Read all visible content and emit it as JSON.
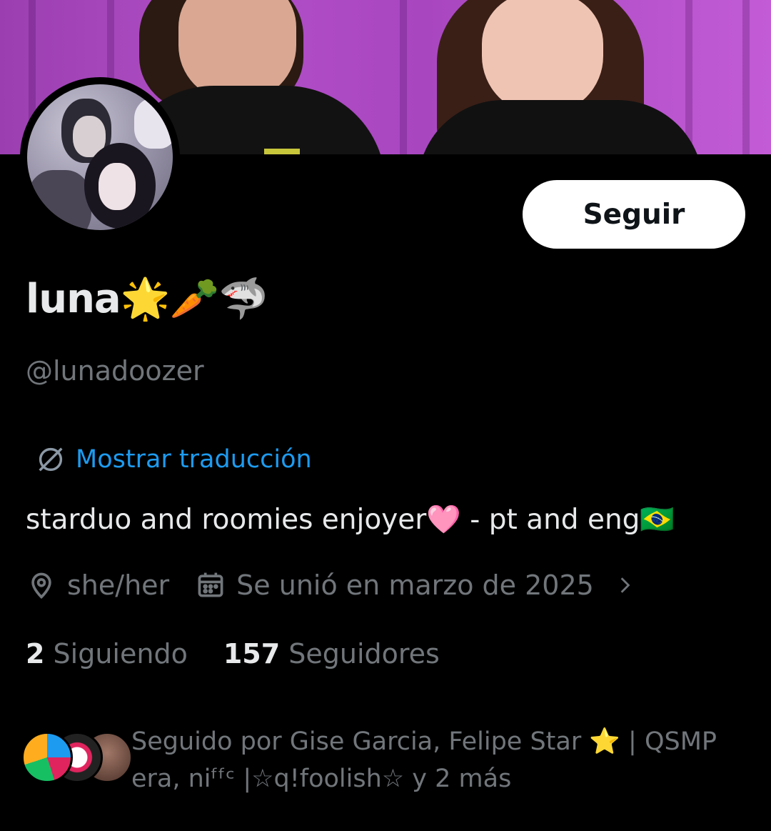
{
  "profile": {
    "display_name": "luna🌟🥕🦈",
    "handle": "@lunadoozer",
    "follow_label": "Seguir",
    "translate_label": "Mostrar traducción",
    "bio": "starduo and roomies enjoyer🩷 - pt and eng🇧🇷",
    "pronouns": "she/her",
    "joined": "Se unió en marzo de 2025",
    "following_count": "2",
    "following_label": "Siguiendo",
    "followers_count": "157",
    "followers_label": "Seguidores",
    "followed_by": "Seguido por Gise Garcia, Felipe Star ⭐ | QSMP era, niᶠᶠᶜ |☆q!foolish☆ y 2 más"
  },
  "icons": {
    "translate": "globe-slash-icon",
    "location": "location-pin-icon",
    "calendar": "calendar-icon",
    "chevron": "chevron-right-icon"
  },
  "colors": {
    "background": "#000000",
    "text_primary": "#e7e9ea",
    "text_secondary": "#71767b",
    "link": "#1d9bf0",
    "banner": "#b24fc8"
  }
}
